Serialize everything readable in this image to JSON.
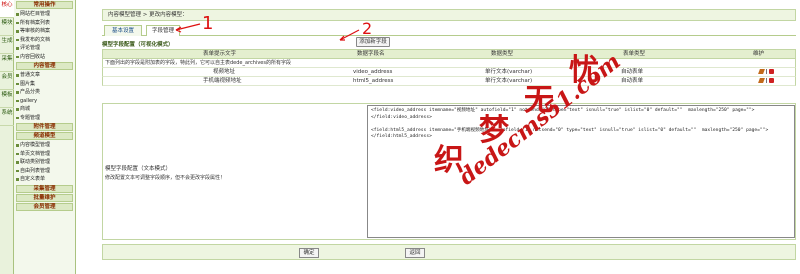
{
  "vertical_tabs": [
    "核心",
    "模块",
    "生成",
    "采集",
    "会员",
    "模板",
    "系统"
  ],
  "sidebar": {
    "sections": [
      {
        "title": "常用操作",
        "items": [
          "网站栏目管理",
          "所有档案列表",
          "等审核的档案",
          "我发布的文档",
          "评论管理",
          "内容回收站"
        ]
      },
      {
        "title": "内容管理",
        "items": [
          "普通文章",
          "图片集",
          "产品分类",
          "gallery",
          "商城",
          "专题管理"
        ]
      },
      {
        "title": "附件管理",
        "items": []
      },
      {
        "title": "频道模型",
        "items": [
          "内容模型管理",
          "单页文档管理",
          "联动类别管理",
          "自由列表管理",
          "自定义表单"
        ]
      },
      {
        "title": "采集管理",
        "items": []
      },
      {
        "title": "批量维护",
        "items": []
      },
      {
        "title": "会员管理",
        "items": []
      }
    ]
  },
  "breadcrumb": "内容模型管理 > 更改内容模型：",
  "tabs": [
    "基本设置",
    "字段管理"
  ],
  "visual_section_title": "模型字段配置（可视化模式）",
  "add_field_button": "添加新字段",
  "table": {
    "headers": [
      "表单提示文字",
      "数据字段名",
      "数据类型",
      "表单类型",
      "维护"
    ],
    "desc": "下面列出的字段是附加表的字段，特此列，它可以自主表dede_archives的所有字段",
    "rows": [
      {
        "label": "视频地址",
        "field": "video_address",
        "type": "单行文本(varchar)",
        "form": "自动表单"
      },
      {
        "label": "手机端视频地址",
        "field": "html5_address",
        "type": "单行文本(varchar)",
        "form": "自动表单"
      }
    ]
  },
  "text_mode": {
    "label": "模型字段配置（文本模式）",
    "hint": "修改配置文本可调整字段顺序，但不会更改字段属性！",
    "content": "<field:video_address itemname=\"视频地址\" autofield=\"1\" notsend=\"0\" type=\"text\" isnull=\"true\" islist=\"0\" default=\"\"  maxlength=\"250\" page=\"\">\n</field:video_address>\n\n<field:html5_address itemname=\"手机端视频地址\" autofield=\"1\" notsend=\"0\" type=\"text\" isnull=\"true\" islist=\"0\" default=\"\"  maxlength=\"250\" page=\"\">\n</field:html5_address>"
  },
  "buttons": {
    "ok": "确定",
    "back": "返回"
  },
  "watermark": {
    "cn": [
      "织",
      "梦",
      "无",
      "忧"
    ],
    "url": "dedecms51.com"
  },
  "annotations": [
    "1",
    "2"
  ],
  "colors": {
    "theme_green": "#a9c27f",
    "accent_red": "#c81616",
    "tab_header": "#e4efcf"
  }
}
